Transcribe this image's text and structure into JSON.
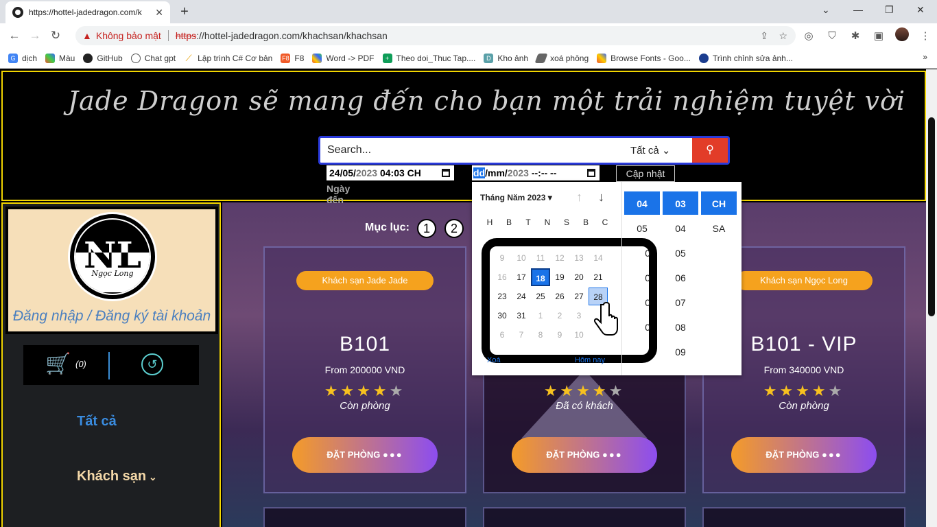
{
  "browser": {
    "tab_title": "https://hottel-jadedragon.com/k",
    "tab_close": "✕",
    "new_tab": "+",
    "security_label": "Không bảo mật",
    "url_scheme": "https",
    "url_rest": "://hottel-jadedragon.com/khachsan/khachsan",
    "bookmarks": [
      "dịch",
      "Màu",
      "GitHub",
      "Chat gpt",
      "Lập trình C# Cơ bản",
      "F8",
      "Word -> PDF",
      "Theo doi_Thuc Tap....",
      "Kho ảnh",
      "xoá phông",
      "Browse Fonts - Goo...",
      "Trình chỉnh sửa ảnh..."
    ],
    "bookmarks_more": "»"
  },
  "header": {
    "slogan": "Jade Dragon sẽ mang đến cho bạn một trải nghiệm tuyệt vời",
    "search_placeholder": "Search...",
    "search_filter": "Tất cả",
    "checkin_date": "24/05/",
    "checkin_year": "2023",
    "checkin_time": " 04:03 CH",
    "checkout_dd": "dd",
    "checkout_mm": "/mm/",
    "checkout_year": "2023",
    "checkout_time": " --:-- --",
    "update_button": "Cập nhật",
    "checkin_label": "Ngày đến"
  },
  "sidebar": {
    "logo_letters": "NL",
    "logo_name": "Ngọc Long",
    "login_text": "Đăng nhập / Đăng ký tài khoản",
    "cart_count": "(0)",
    "menu_all": "Tất cả",
    "menu_hotels": "Khách sạn"
  },
  "main": {
    "index_label": "Mục lục:",
    "pages": [
      "1",
      "2"
    ],
    "cards": [
      {
        "hotel": "Khách sạn Jade Jade",
        "room": "B101",
        "price": "From 200000 VND",
        "rating": 4,
        "status": "Còn phòng",
        "book": "ĐẶT PHÒNG"
      },
      {
        "hotel": "",
        "room": "",
        "price": "",
        "rating": 4,
        "status": "Đã có khách",
        "book": "ĐẶT PHÒNG"
      },
      {
        "hotel": "Khách sạn Ngọc Long",
        "room": "B101 - VIP",
        "price": "From 340000 VND",
        "rating": 4,
        "status": "Còn phòng",
        "book": "ĐẶT PHÒNG"
      }
    ]
  },
  "picker": {
    "month_label": "Tháng Năm 2023 ▾",
    "weekdays": [
      "H",
      "B",
      "T",
      "N",
      "S",
      "B",
      "C"
    ],
    "rows": [
      [
        "9",
        "10",
        "11",
        "12",
        "13",
        "14"
      ],
      [
        "16",
        "17",
        "18",
        "19",
        "20",
        "21"
      ],
      [
        "23",
        "24",
        "25",
        "26",
        "27",
        "28"
      ],
      [
        "30",
        "31",
        "1",
        "2",
        "3"
      ],
      [
        "6",
        "7",
        "8",
        "9",
        "10"
      ]
    ],
    "today": "18",
    "hovered": "28",
    "clear": "Xoá",
    "today_btn": "Hôm nay",
    "hours": [
      "04",
      "05",
      "0",
      "0",
      "0",
      "0"
    ],
    "minutes": [
      "03",
      "04",
      "05",
      "06",
      "07",
      "08",
      "09"
    ],
    "ampm": [
      "CH",
      "SA"
    ]
  },
  "colors": {
    "accent": "#1a73e8",
    "border_yellow": "#f2d500",
    "badge": "#f5a21e",
    "search_btn": "#e23c28"
  }
}
